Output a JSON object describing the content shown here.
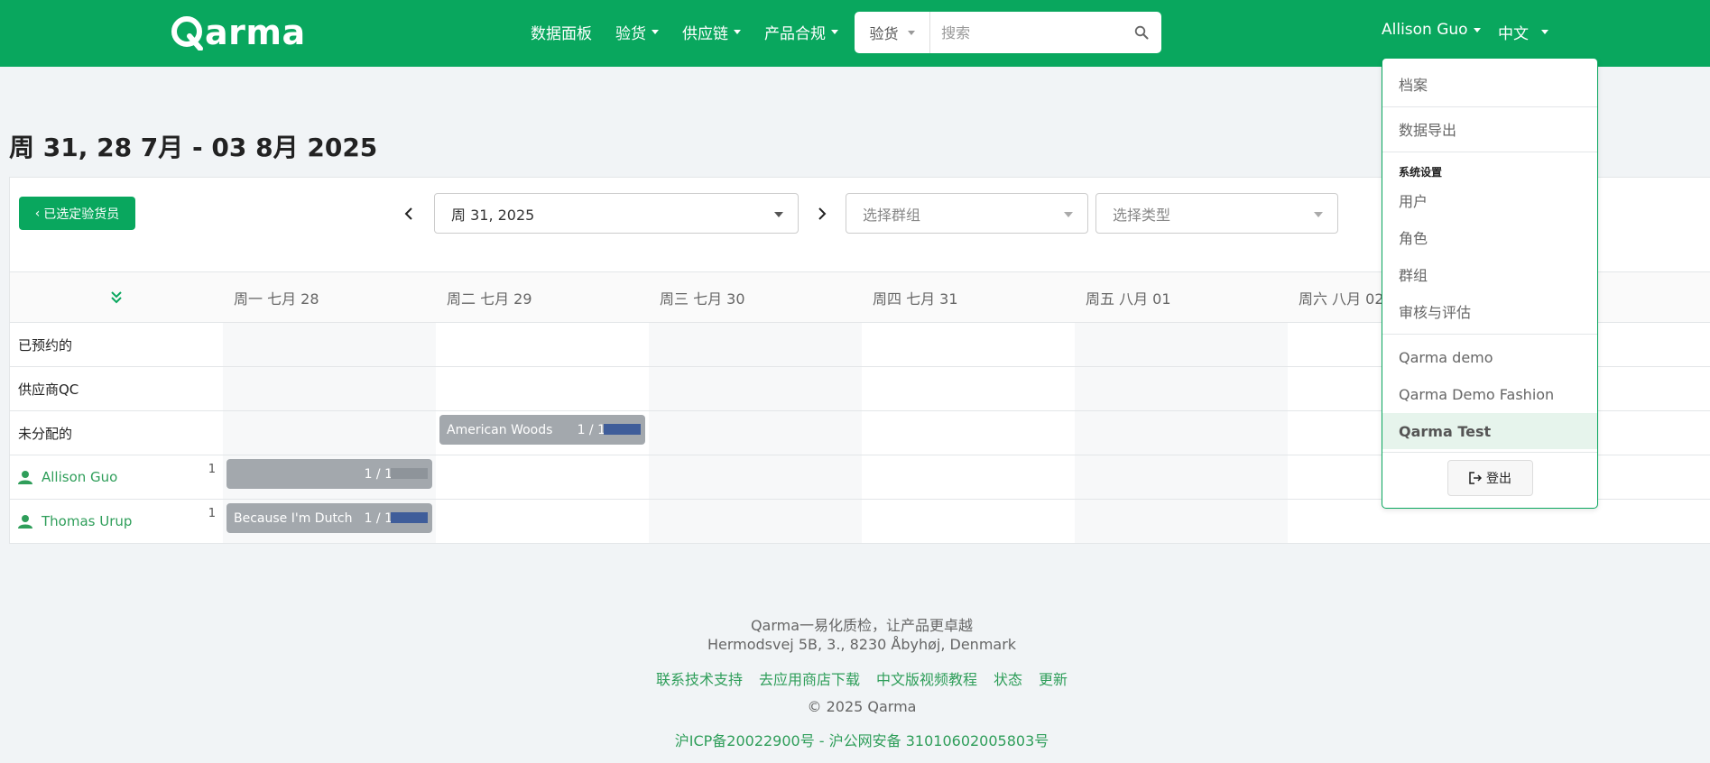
{
  "navbar": {
    "logo_text": "arma",
    "links": [
      {
        "label": "数据面板",
        "caret": false
      },
      {
        "label": "验货",
        "caret": true
      },
      {
        "label": "供应链",
        "caret": true
      },
      {
        "label": "产品合规",
        "caret": true
      }
    ],
    "search": {
      "type_label": "验货",
      "placeholder": "搜索"
    },
    "user": "Allison Guo",
    "language": "中文"
  },
  "page": {
    "title": "周 31, 28 7月 - 03 8月 2025"
  },
  "toolbar": {
    "back_button": "已选定验货员",
    "prev_icon": "chevron-left",
    "next_icon": "chevron-right",
    "week_select": "周 31, 2025",
    "group_placeholder": "选择群组",
    "type_placeholder": "选择类型"
  },
  "calendar": {
    "days": [
      "周一 七月 28",
      "周二 七月 29",
      "周三 七月 30",
      "周四 七月 31",
      "周五 八月 01",
      "周六 八月 02"
    ],
    "rows": [
      {
        "label": "已预约的",
        "type": "category"
      },
      {
        "label": "供应商QC",
        "type": "category"
      },
      {
        "label": "未分配的",
        "type": "category"
      },
      {
        "label": "Allison Guo",
        "type": "user",
        "count": "1"
      },
      {
        "label": "Thomas Urup",
        "type": "user",
        "count": "1"
      }
    ],
    "chips": {
      "unassigned_tue": {
        "label": "American Woods",
        "count": "1 / 1",
        "progress": 1.0
      },
      "allison_mon": {
        "label": "",
        "count": "1 / 1",
        "progress": 0.0
      },
      "thomas_mon": {
        "label": "Because I'm Dutch",
        "count": "1 / 1",
        "progress": 1.0
      }
    }
  },
  "dropdown": {
    "items_top": [
      "档案",
      "数据导出"
    ],
    "settings_header": "系统设置",
    "settings_items": [
      "用户",
      "角色",
      "群组",
      "审核与评估"
    ],
    "companies": [
      "Qarma demo",
      "Qarma Demo Fashion",
      "Qarma Test"
    ],
    "active_company": "Qarma Test",
    "logout": "登出"
  },
  "footer": {
    "tagline": "Qarma一易化质检，让产品更卓越",
    "address": "Hermodsvej 5B, 3., 8230 Åbyhøj, Denmark",
    "links": [
      "联系技术支持",
      "去应用商店下载",
      "中文版视频教程",
      "状态",
      "更新"
    ],
    "copyright": "© 2025 Qarma",
    "icp": "沪ICP备20022900号 - 沪公网安备 31010602005803号"
  },
  "colors": {
    "brand": "#09a75e",
    "chip_gray": "#a3a8ad",
    "progress_fill": "#3f5d9a",
    "link_green": "#2f9e5a"
  }
}
